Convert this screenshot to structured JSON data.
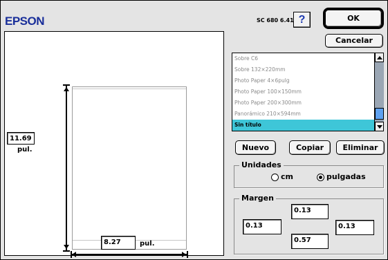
{
  "header": {
    "brand": "EPSON",
    "model": "SC 680 6.41S",
    "help_label": "?",
    "ok_label": "OK",
    "cancel_label": "Cancelar"
  },
  "preview": {
    "height_value": "11.69",
    "height_unit": "pul.",
    "width_value": "8.27",
    "width_unit": "pul."
  },
  "paper_list": {
    "items": [
      "Sobre C6",
      "Sobre 132×220mm",
      "Photo Paper 4×6pulg",
      "Photo Paper 100×150mm",
      "Photo Paper 200×300mm",
      "Panorámico 210×594mm",
      "Sin título"
    ],
    "selected_index": 6
  },
  "actions": {
    "new_label": "Nuevo",
    "copy_label": "Copiar",
    "delete_label": "Eliminar"
  },
  "units": {
    "label": "Unidades",
    "options": [
      "cm",
      "pulgadas"
    ],
    "selected": "pulgadas"
  },
  "margins": {
    "label": "Margen",
    "top": "0.13",
    "left": "0.13",
    "right": "0.13",
    "bottom": "0.57"
  },
  "colors": {
    "brand": "#1a2f9a",
    "selection": "#3ec6d8",
    "scroll_thumb": "#5ea1f0"
  }
}
